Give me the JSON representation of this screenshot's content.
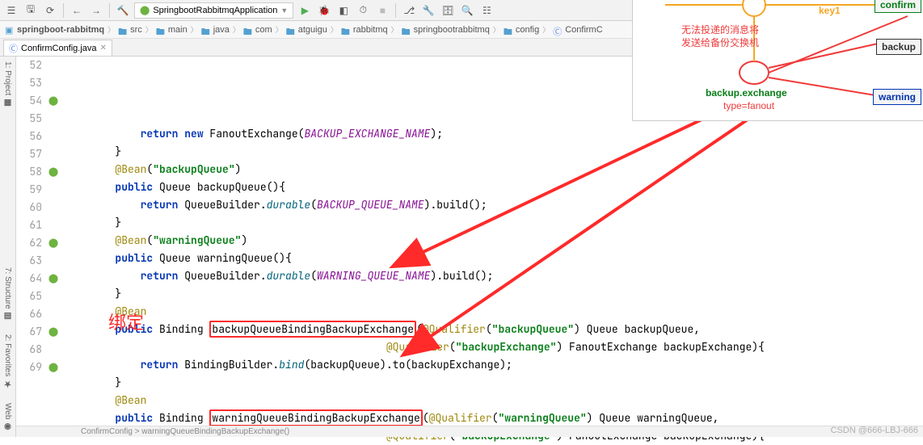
{
  "toolbar": {
    "tooltips": [
      "menu",
      "open",
      "save",
      "refresh",
      "back",
      "forward",
      "build",
      "sync"
    ],
    "run_config": "SpringbootRabbitmqApplication",
    "run_icons": [
      "run",
      "debug",
      "coverage",
      "profile",
      "stop",
      "layout",
      "avd",
      "wrench",
      "db",
      "find",
      "git"
    ]
  },
  "breadcrumbs": [
    {
      "icon": "module",
      "label": "springboot-rabbitmq"
    },
    {
      "icon": "folder",
      "label": "src"
    },
    {
      "icon": "folder",
      "label": "main"
    },
    {
      "icon": "folder",
      "label": "java"
    },
    {
      "icon": "folder",
      "label": "com"
    },
    {
      "icon": "folder",
      "label": "atguigu"
    },
    {
      "icon": "folder",
      "label": "rabbitmq"
    },
    {
      "icon": "folder",
      "label": "springbootrabbitmq"
    },
    {
      "icon": "folder",
      "label": "config"
    },
    {
      "icon": "class",
      "label": "ConfirmC"
    }
  ],
  "tab": {
    "file": "ConfirmConfig.java"
  },
  "sidetools": [
    "1: Project",
    "7: Structure",
    "2: Favorites",
    "Web"
  ],
  "annotation_label": "绑定",
  "status_crumb": "ConfirmConfig  >  warningQueueBindingBackupExchange()",
  "watermark": "CSDN @666-LBJ-666",
  "diagram": {
    "key_label": "key1",
    "note_line1": "无法投递的消息将",
    "note_line2": "发送给备份交换机",
    "exchange_name": "backup.exchange",
    "exchange_type": "type=fanout",
    "node_confirm": "confirm",
    "node_backup": "backup",
    "node_warning": "warning"
  },
  "code_lines": [
    {
      "n": 52,
      "gutter": "",
      "indent": "            ",
      "tokens": [
        [
          "kw",
          "return"
        ],
        [
          "",
          ""
        ],
        [
          "kw",
          " new"
        ],
        [
          "",
          " FanoutExchange("
        ],
        [
          "const-it",
          "BACKUP_EXCHANGE_NAME"
        ],
        [
          "",
          ");"
        ]
      ]
    },
    {
      "n": 53,
      "gutter": "",
      "indent": "        ",
      "tokens": [
        [
          "",
          "}"
        ]
      ]
    },
    {
      "n": 54,
      "gutter": "spring",
      "indent": "        ",
      "tokens": [
        [
          "ann",
          "@Bean"
        ],
        [
          "",
          "("
        ],
        [
          "str",
          "\"backupQueue\""
        ],
        [
          "",
          ")"
        ]
      ]
    },
    {
      "n": 55,
      "gutter": "",
      "indent": "        ",
      "tokens": [
        [
          "kw",
          "public"
        ],
        [
          "",
          " Queue backupQueue(){"
        ]
      ]
    },
    {
      "n": 56,
      "gutter": "",
      "indent": "            ",
      "tokens": [
        [
          "kw",
          "return"
        ],
        [
          "",
          " QueueBuilder."
        ],
        [
          "fn-it",
          "durable"
        ],
        [
          "",
          "("
        ],
        [
          "const-it",
          "BACKUP_QUEUE_NAME"
        ],
        [
          "",
          ").build();"
        ]
      ]
    },
    {
      "n": 57,
      "gutter": "",
      "indent": "        ",
      "tokens": [
        [
          "",
          "}"
        ]
      ]
    },
    {
      "n": 58,
      "gutter": "spring",
      "indent": "        ",
      "tokens": [
        [
          "ann",
          "@Bean"
        ],
        [
          "",
          "("
        ],
        [
          "str",
          "\"warningQueue\""
        ],
        [
          "",
          ")"
        ]
      ]
    },
    {
      "n": 59,
      "gutter": "",
      "indent": "        ",
      "tokens": [
        [
          "kw",
          "public"
        ],
        [
          "",
          " Queue warningQueue(){"
        ]
      ]
    },
    {
      "n": 60,
      "gutter": "",
      "indent": "            ",
      "tokens": [
        [
          "kw",
          "return"
        ],
        [
          "",
          " QueueBuilder."
        ],
        [
          "fn-it",
          "durable"
        ],
        [
          "",
          "("
        ],
        [
          "const-it",
          "WARNING_QUEUE_NAME"
        ],
        [
          "",
          ").build();"
        ]
      ]
    },
    {
      "n": 61,
      "gutter": "",
      "indent": "        ",
      "tokens": [
        [
          "",
          "}"
        ]
      ]
    },
    {
      "n": 62,
      "gutter": "spring",
      "indent": "        ",
      "tokens": [
        [
          "ann",
          "@Bean"
        ]
      ]
    },
    {
      "n": 63,
      "gutter": "",
      "indent": "        ",
      "tokens": [
        [
          "kw",
          "public"
        ],
        [
          "",
          " Binding "
        ],
        [
          "redbox",
          "backupQueueBindingBackupExchange"
        ],
        [
          "",
          "("
        ],
        [
          "ann",
          "@Qualifier"
        ],
        [
          "",
          "("
        ],
        [
          "str",
          "\"backupQueue\""
        ],
        [
          "",
          ") Queue backupQueue,"
        ]
      ]
    },
    {
      "n": 64,
      "gutter": "spring",
      "indent": "                                                   ",
      "tokens": [
        [
          "ann",
          "@Qualifier"
        ],
        [
          "",
          "("
        ],
        [
          "str",
          "\"backupExchange\""
        ],
        [
          "",
          ") FanoutExchange backupExchange){"
        ]
      ]
    },
    {
      "n": 65,
      "gutter": "",
      "indent": "            ",
      "tokens": [
        [
          "kw",
          "return"
        ],
        [
          "",
          " BindingBuilder."
        ],
        [
          "fn-it",
          "bind"
        ],
        [
          "",
          "(backupQueue).to(backupExchange);"
        ]
      ]
    },
    {
      "n": 66,
      "gutter": "",
      "indent": "        ",
      "tokens": [
        [
          "",
          "}"
        ]
      ]
    },
    {
      "n": 67,
      "gutter": "spring",
      "indent": "        ",
      "tokens": [
        [
          "ann",
          "@Bean"
        ]
      ]
    },
    {
      "n": 68,
      "gutter": "",
      "indent": "        ",
      "tokens": [
        [
          "kw",
          "public"
        ],
        [
          "",
          " Binding "
        ],
        [
          "redbox",
          "warningQueueBindingBackupExchange"
        ],
        [
          "",
          "("
        ],
        [
          "ann",
          "@Qualifier"
        ],
        [
          "",
          "("
        ],
        [
          "str",
          "\"warningQueue\""
        ],
        [
          "",
          ") Queue warningQueue,"
        ]
      ]
    },
    {
      "n": 69,
      "gutter": "spring",
      "indent": "                                                   ",
      "tokens": [
        [
          "ann",
          "@Qualifier"
        ],
        [
          "",
          "("
        ],
        [
          "str",
          "\"backupExchange\""
        ],
        [
          "",
          ") FanoutExchange backupExchange){"
        ]
      ]
    }
  ]
}
